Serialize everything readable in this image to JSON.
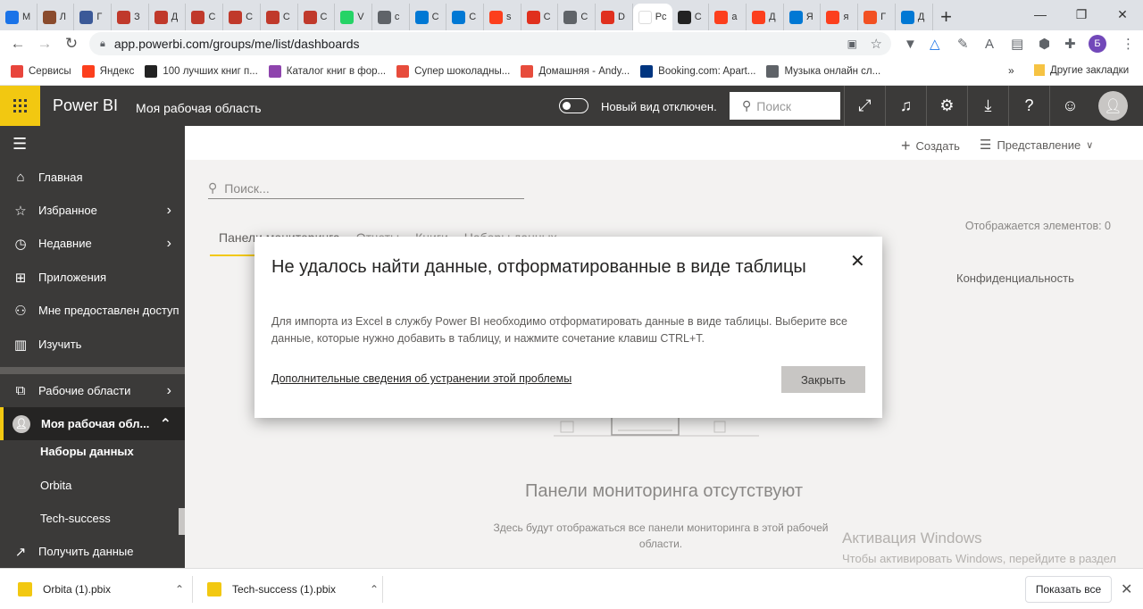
{
  "browser": {
    "tabs": [
      {
        "label": "М",
        "color": "#1a73e8"
      },
      {
        "label": "Л",
        "color": "#8a4b2d"
      },
      {
        "label": "Г",
        "color": "#3b5998"
      },
      {
        "label": "З",
        "color": "#c0392b"
      },
      {
        "label": "Д",
        "color": "#c0392b"
      },
      {
        "label": "С",
        "color": "#c0392b"
      },
      {
        "label": "С",
        "color": "#c0392b"
      },
      {
        "label": "С",
        "color": "#c0392b"
      },
      {
        "label": "С",
        "color": "#c0392b"
      },
      {
        "label": "V",
        "color": "#25d366"
      },
      {
        "label": "c",
        "color": "#5f6368"
      },
      {
        "label": "С",
        "color": "#0078d4"
      },
      {
        "label": "С",
        "color": "#0078d4"
      },
      {
        "label": "s",
        "color": "#fc3f1d"
      },
      {
        "label": "С",
        "color": "#e0301e"
      },
      {
        "label": "С",
        "color": "#5f6368"
      },
      {
        "label": "D",
        "color": "#e0301e"
      },
      {
        "label": "Pc",
        "color": "#ffffff",
        "active": true
      },
      {
        "label": "С",
        "color": "#222222"
      },
      {
        "label": "a",
        "color": "#fc3f1d"
      },
      {
        "label": "Д",
        "color": "#fc3f1d"
      },
      {
        "label": "Я",
        "color": "#0078d4"
      },
      {
        "label": "я",
        "color": "#fc3f1d"
      },
      {
        "label": "Г",
        "color": "#f25022"
      },
      {
        "label": "Д",
        "color": "#0078d4"
      }
    ],
    "active_tab_close": "✕",
    "new_tab": "+",
    "window_controls": [
      "—",
      "❐",
      "✕"
    ],
    "url": "app.powerbi.com/groups/me/list/dashboards",
    "profile_initial": "Б",
    "bookmarks": [
      {
        "label": "Сервисы",
        "color": "#e8453c"
      },
      {
        "label": "Яндекс",
        "color": "#fc3f1d"
      },
      {
        "label": "100 лучших книг п...",
        "color": "#222222"
      },
      {
        "label": "Каталог книг в фор...",
        "color": "#8e44ad"
      },
      {
        "label": "Супер шоколадны...",
        "color": "#e74c3c"
      },
      {
        "label": "Домашняя - Andy...",
        "color": "#e74c3c"
      },
      {
        "label": "Booking.com: Apart...",
        "color": "#003580"
      },
      {
        "label": "Музыка онлайн сл...",
        "color": "#5f6368"
      }
    ],
    "bookmarks_more": "»",
    "other_bookmarks": "Другие закладки"
  },
  "header": {
    "brand": "Power BI",
    "workspace": "Моя рабочая область",
    "toggle_label": "Новый вид отключен.",
    "search_placeholder": "Поиск"
  },
  "sidebar": {
    "items": [
      {
        "label": "Главная",
        "icon": "⌂"
      },
      {
        "label": "Избранное",
        "icon": "☆",
        "chevron": "›"
      },
      {
        "label": "Недавние",
        "icon": "◷",
        "chevron": "›"
      },
      {
        "label": "Приложения",
        "icon": "⊞"
      },
      {
        "label": "Мне предоставлен доступ",
        "icon": "⚇"
      },
      {
        "label": "Изучить",
        "icon": "▥"
      },
      {
        "label": "Рабочие области",
        "icon": "⧉",
        "chevron": "›"
      },
      {
        "label": "Моя рабочая обл...",
        "chevron": "⌃"
      },
      {
        "label": "Наборы данных"
      },
      {
        "label": "Orbita"
      },
      {
        "label": "Tech-success"
      },
      {
        "label": "Получить данные",
        "icon": "↗"
      }
    ]
  },
  "main": {
    "create_label": "Создать",
    "view_label": "Представление",
    "search_placeholder": "Поиск...",
    "items_count": "Отображается элементов: 0",
    "tabs": [
      "Панели мониторинга",
      "Отчеты",
      "Книги",
      "Наборы данных"
    ],
    "privacy_header": "Конфиденциальность",
    "empty_title": "Панели мониторинга отсутствуют",
    "empty_desc": "Здесь будут отображаться все панели мониторинга в этой рабочей области."
  },
  "modal": {
    "title": "Не удалось найти данные, отформатированные в виде таблицы",
    "body": "Для импорта из Excel в службу Power BI необходимо отформатировать данные в виде таблицы. Выберите все данные, которые нужно добавить в таблицу, и нажмите сочетание клавиш CTRL+T.",
    "link": "Дополнительные сведения об устранении этой проблемы",
    "close_button": "Закрыть"
  },
  "activation": {
    "title": "Активация Windows",
    "text": "Чтобы активировать Windows, перейдите в раздел \"Параметры\"."
  },
  "downloads": {
    "files": [
      "Orbita (1).pbix",
      "Tech-success (1).pbix"
    ],
    "show_all": "Показать все"
  }
}
